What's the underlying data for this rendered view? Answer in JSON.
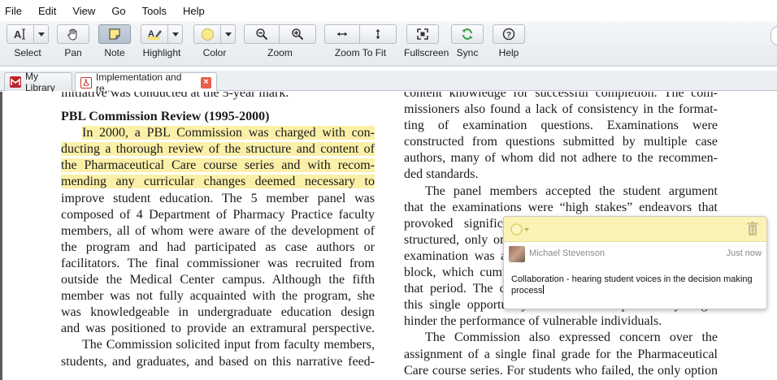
{
  "menu": {
    "items": [
      "File",
      "Edit",
      "View",
      "Go",
      "Tools",
      "Help"
    ]
  },
  "toolbar": {
    "select": "Select",
    "pan": "Pan",
    "note": "Note",
    "highlight": "Highlight",
    "color": "Color",
    "zoom": "Zoom",
    "zoom_to_fit": "Zoom To Fit",
    "fullscreen": "Fullscreen",
    "sync": "Sync",
    "help": "Help",
    "highlight_color": "#f6e27a",
    "sync_color": "#2e9e3a"
  },
  "tabs": {
    "library": "My Library",
    "document": "Implementation and re..."
  },
  "document": {
    "left": [
      "initiative was conducted at the 5-year mark.",
      "",
      "PBL Commission Review (1995-2000)",
      "In 2000, a PBL Commission was charged with con-",
      "ducting a thorough review of the structure and content of",
      "the Pharmaceutical Care course series and with recom-",
      "mending any curricular changes deemed necessary to",
      "improve student education. The 5 member panel was",
      "composed of 4 Department of Pharmacy Practice faculty",
      "members, all of whom were aware of the development of",
      "the program and had participated as case authors or",
      "facilitators. The final commissioner was recruited from",
      "outside the Medical Center campus. Although the fifth",
      "member was not fully acquainted with the program, she",
      "was knowledgeable in undergraduate education design",
      "and was positioned to provide an extramural perspective.",
      "The Commission solicited input from faculty members,",
      "students, and graduates, and based on this narrative feed-"
    ],
    "right": [
      "content knowledge for successful completion. The com-",
      "missioners also found a lack of consistency in the format-",
      "ting of examination questions. Examinations were",
      "constructed from questions submitted by multiple case",
      "authors, many of whom did not adhere to the recommen-",
      "ded standards.",
      "The panel members accepted the student argument",
      "that the examinations were “high stakes” endeavors that",
      "provoked significant anxiety. The examinations were",
      "structured, only one examination was given, and a single",
      "examination was administered at the end of each course",
      "block, which cumulatively assessed knowledge gained in",
      "that period. The course-level grade was dependent upon",
      "this single opportunity to demonstrate proficiency might",
      "hinder the performance of vulnerable individuals.",
      "The Commission also expressed concern over the",
      "assignment of a single final grade for the Pharmaceutical",
      "Care course series. For students who failed, the only option"
    ]
  },
  "note": {
    "author": "Michael Stevenson",
    "time": "Just now",
    "text": "Collaboration - hearing student voices in the decision making process"
  }
}
